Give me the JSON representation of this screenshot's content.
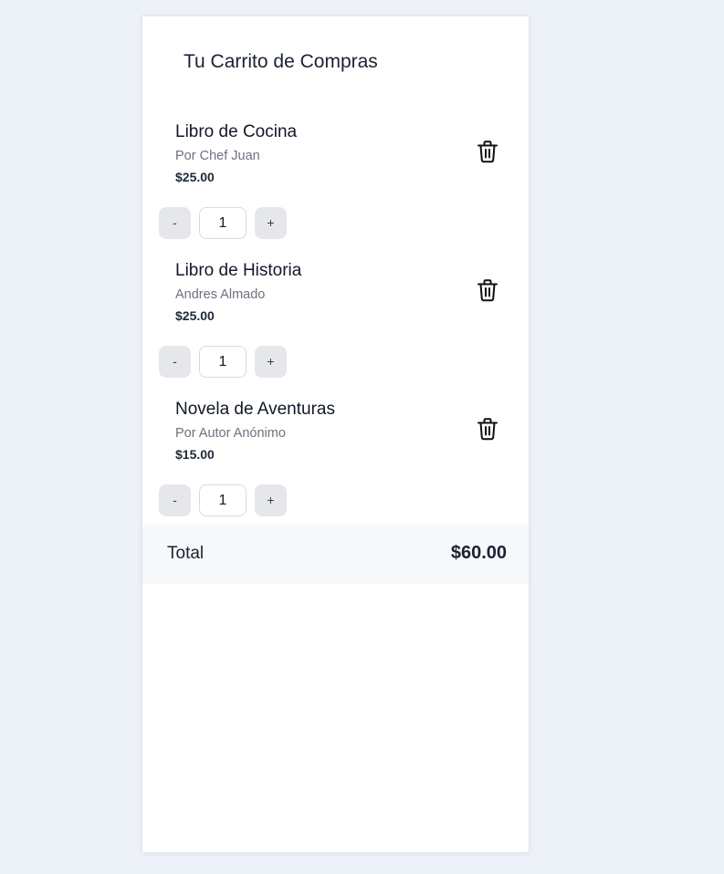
{
  "cart": {
    "title": "Tu Carrito de Compras",
    "items": [
      {
        "name": "Libro de Cocina",
        "author": "Por Chef Juan",
        "price": "$25.00",
        "quantity": "1",
        "decrement_label": "-",
        "increment_label": "+",
        "delete_icon": "trash-icon"
      },
      {
        "name": "Libro de Historia",
        "author": "Andres Almado",
        "price": "$25.00",
        "quantity": "1",
        "decrement_label": "-",
        "increment_label": "+",
        "delete_icon": "trash-icon"
      },
      {
        "name": "Novela de Aventuras",
        "author": "Por Autor Anónimo",
        "price": "$15.00",
        "quantity": "1",
        "decrement_label": "-",
        "increment_label": "+",
        "delete_icon": "trash-icon"
      }
    ],
    "total_label": "Total",
    "total_value": "$60.00"
  },
  "colors": {
    "page_background": "#edf1f8",
    "panel_background": "#ffffff",
    "text_primary": "#1a2233",
    "text_muted": "#6b7280",
    "button_background": "#e5e7eb",
    "total_bar_background": "#f7f8fa"
  }
}
